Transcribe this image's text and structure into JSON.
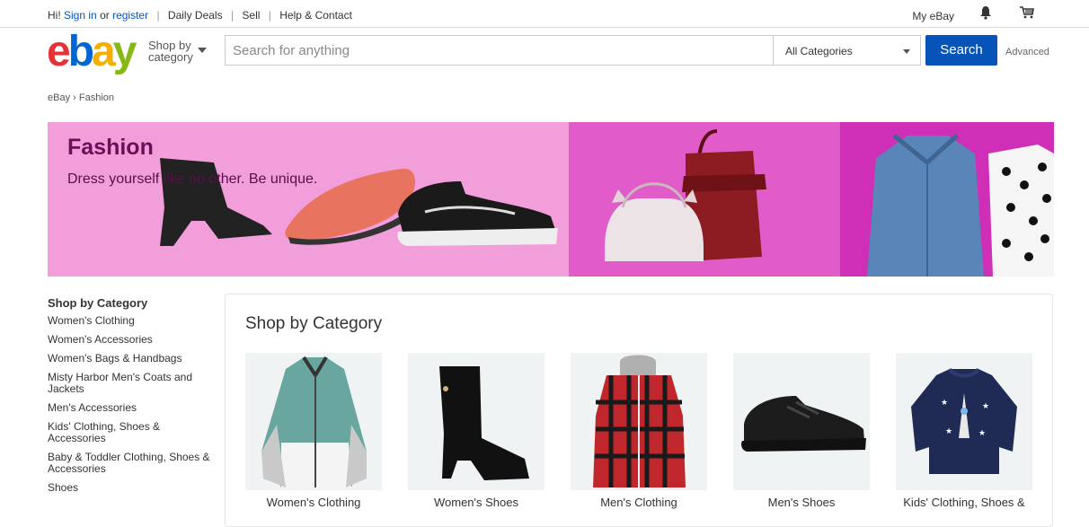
{
  "topbar": {
    "greeting": "Hi!",
    "sign_in": "Sign in",
    "or": "or",
    "register": "register",
    "links": [
      "Daily Deals",
      "Sell",
      "Help & Contact"
    ],
    "my_ebay": "My eBay"
  },
  "header": {
    "logo": {
      "e": "e",
      "b": "b",
      "a": "a",
      "y": "y"
    },
    "shop_by_line1": "Shop by",
    "shop_by_line2": "category",
    "search_placeholder": "Search for anything",
    "category_select": "All Categories",
    "search_button": "Search",
    "advanced": "Advanced"
  },
  "breadcrumb": {
    "root": "eBay",
    "separator": "›",
    "current": "Fashion"
  },
  "hero": {
    "title": "Fashion",
    "tagline": "Dress yourself like no other. Be unique."
  },
  "sidebar": {
    "title": "Shop by Category",
    "items": [
      "Women's Clothing",
      "Women's Accessories",
      "Women's Bags & Handbags",
      "Misty Harbor Men's Coats and Jackets",
      "Men's Accessories",
      "Kids' Clothing, Shoes & Accessories",
      "Baby & Toddler Clothing, Shoes & Accessories",
      "Shoes"
    ]
  },
  "main": {
    "title": "Shop by Category",
    "cards": [
      {
        "label": "Women's Clothing"
      },
      {
        "label": "Women's Shoes"
      },
      {
        "label": "Men's Clothing"
      },
      {
        "label": "Men's Shoes"
      },
      {
        "label": "Kids' Clothing, Shoes &"
      }
    ]
  },
  "colors": {
    "accent": "#0654ba",
    "hero_pink": "#f19edb",
    "hero_magenta": "#e25cc9"
  }
}
